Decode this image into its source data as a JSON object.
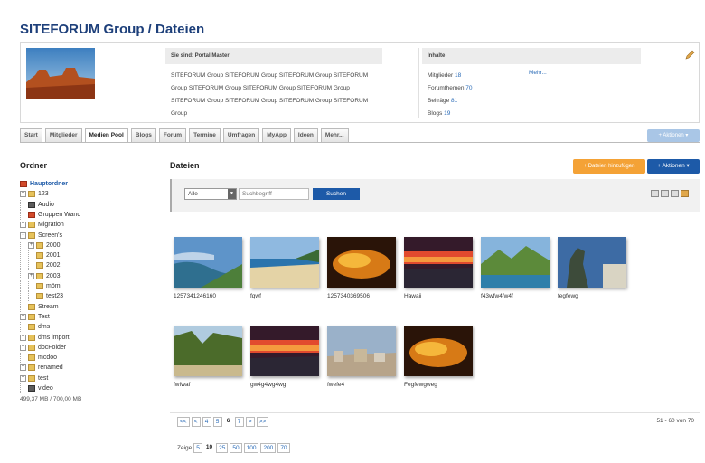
{
  "page": {
    "title": "SITEFORUM Group / Dateien"
  },
  "header": {
    "location_label": "Sie sind: Portal Master",
    "description": "SITEFORUM Group SITEFORUM Group SITEFORUM Group SITEFORUM Group SITEFORUM Group SITEFORUM Group SITEFORUM Group SITEFORUM Group SITEFORUM Group SITEFORUM Group SITEFORUM Group",
    "stats_label": "Inhalte",
    "stats": [
      {
        "label": "Mitglieder",
        "value": "18"
      },
      {
        "label": "Forumthemen",
        "value": "70"
      },
      {
        "label": "Beiträge",
        "value": "81"
      },
      {
        "label": "Blogs",
        "value": "19"
      }
    ],
    "more_link": "Mehr..."
  },
  "tabs": [
    "Start",
    "Mitglieder",
    "Medien Pool",
    "Blogs",
    "Forum",
    "Termine",
    "Umfragen",
    "MyApp",
    "Ideen",
    "Mehr..."
  ],
  "active_tab": "Medien Pool",
  "top_actions_label": "Aktionen",
  "folders": {
    "title": "Ordner",
    "items": [
      {
        "label": "Hauptordner",
        "depth": 0,
        "toggle": "",
        "color": "red"
      },
      {
        "label": "123",
        "depth": 0,
        "toggle": "+",
        "color": "yellow"
      },
      {
        "label": "Audio",
        "depth": 0,
        "toggle": "",
        "color": "dark"
      },
      {
        "label": "Gruppen Wand",
        "depth": 0,
        "toggle": "",
        "color": "red"
      },
      {
        "label": "Migration",
        "depth": 0,
        "toggle": "+",
        "color": "yellow"
      },
      {
        "label": "Screen's",
        "depth": 0,
        "toggle": "-",
        "color": "yellow"
      },
      {
        "label": "2000",
        "depth": 1,
        "toggle": "+",
        "color": "yellow"
      },
      {
        "label": "2001",
        "depth": 1,
        "toggle": "",
        "color": "yellow"
      },
      {
        "label": "2002",
        "depth": 1,
        "toggle": "",
        "color": "yellow"
      },
      {
        "label": "2003",
        "depth": 1,
        "toggle": "+",
        "color": "yellow"
      },
      {
        "label": "mömi",
        "depth": 1,
        "toggle": "",
        "color": "yellow"
      },
      {
        "label": "test23",
        "depth": 1,
        "toggle": "",
        "color": "yellow"
      },
      {
        "label": "Stream",
        "depth": 0,
        "toggle": "",
        "color": "yellow"
      },
      {
        "label": "Test",
        "depth": 0,
        "toggle": "+",
        "color": "yellow"
      },
      {
        "label": "dms",
        "depth": 0,
        "toggle": "",
        "color": "yellow"
      },
      {
        "label": "dms import",
        "depth": 0,
        "toggle": "+",
        "color": "yellow"
      },
      {
        "label": "docFolder",
        "depth": 0,
        "toggle": "+",
        "color": "yellow"
      },
      {
        "label": "mcdoo",
        "depth": 0,
        "toggle": "",
        "color": "yellow"
      },
      {
        "label": "renamed",
        "depth": 0,
        "toggle": "+",
        "color": "yellow"
      },
      {
        "label": "test",
        "depth": 0,
        "toggle": "+",
        "color": "yellow"
      },
      {
        "label": "video",
        "depth": 0,
        "toggle": "",
        "color": "dark"
      }
    ],
    "storage": "499,37 MB / 700,00 MB"
  },
  "files": {
    "title": "Dateien",
    "add_button": "Dateien hinzufügen",
    "actions_button": "Aktionen",
    "filter": {
      "selected": "Alle",
      "search_placeholder": "Suchbegriff",
      "search_button": "Suchen"
    },
    "items": [
      {
        "label": "1257341246160",
        "scene": "coast"
      },
      {
        "label": "fqwf",
        "scene": "beach"
      },
      {
        "label": "1257340369506",
        "scene": "cloud"
      },
      {
        "label": "Hawaii",
        "scene": "sunset"
      },
      {
        "label": "f43wfw4fw4f",
        "scene": "hills"
      },
      {
        "label": "fegfewg",
        "scene": "statue"
      },
      {
        "label": "fwfwaf",
        "scene": "valley"
      },
      {
        "label": "gw4g4wg4wg",
        "scene": "sunset"
      },
      {
        "label": "fwefe4",
        "scene": "city"
      },
      {
        "label": "Fegfewgweg",
        "scene": "cloud"
      }
    ],
    "pager": {
      "pages": [
        "<<",
        "<",
        "4",
        "5",
        "6",
        "7",
        ">",
        ">>"
      ],
      "current": "6",
      "info": "51 - 60 von 70"
    },
    "per_page": {
      "label": "Zeige",
      "options": [
        "5",
        "10",
        "25",
        "50",
        "100",
        "200",
        "70"
      ],
      "current": "10"
    }
  },
  "colors": {
    "accent": "#1d5aa8",
    "title": "#1d3f7a",
    "orange": "#f4a236"
  }
}
